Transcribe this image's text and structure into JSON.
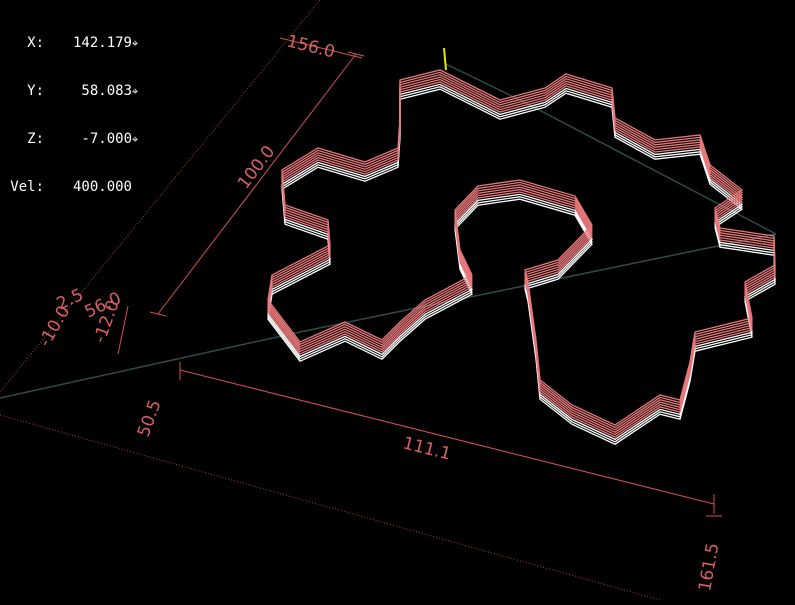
{
  "dro": {
    "x_label": "X:",
    "x_value": "142.179",
    "y_label": "Y:",
    "y_value": "58.083",
    "z_label": "Z:",
    "z_value": "-7.000",
    "vel_label": "Vel:",
    "vel_value": "400.000",
    "homed_mark": "⌖"
  },
  "dimensions": {
    "top_extent": "156.0",
    "depth": "100.0",
    "left_extent_a": "2.5",
    "left_extent_b": "56.0",
    "left_neg_a": "-10.0",
    "left_neg_b": "-12.0",
    "front_offset": "50.5",
    "width": "111.1",
    "right_extent": "161.5"
  },
  "colors": {
    "background": "#000000",
    "toolpath_feed": "#e8787a",
    "toolpath_lower": "#ffffff",
    "extents_lines": "#d35050",
    "traverse": "#2f4a49",
    "tool": "#e6e600"
  },
  "icons": {
    "homed": "target-icon"
  }
}
